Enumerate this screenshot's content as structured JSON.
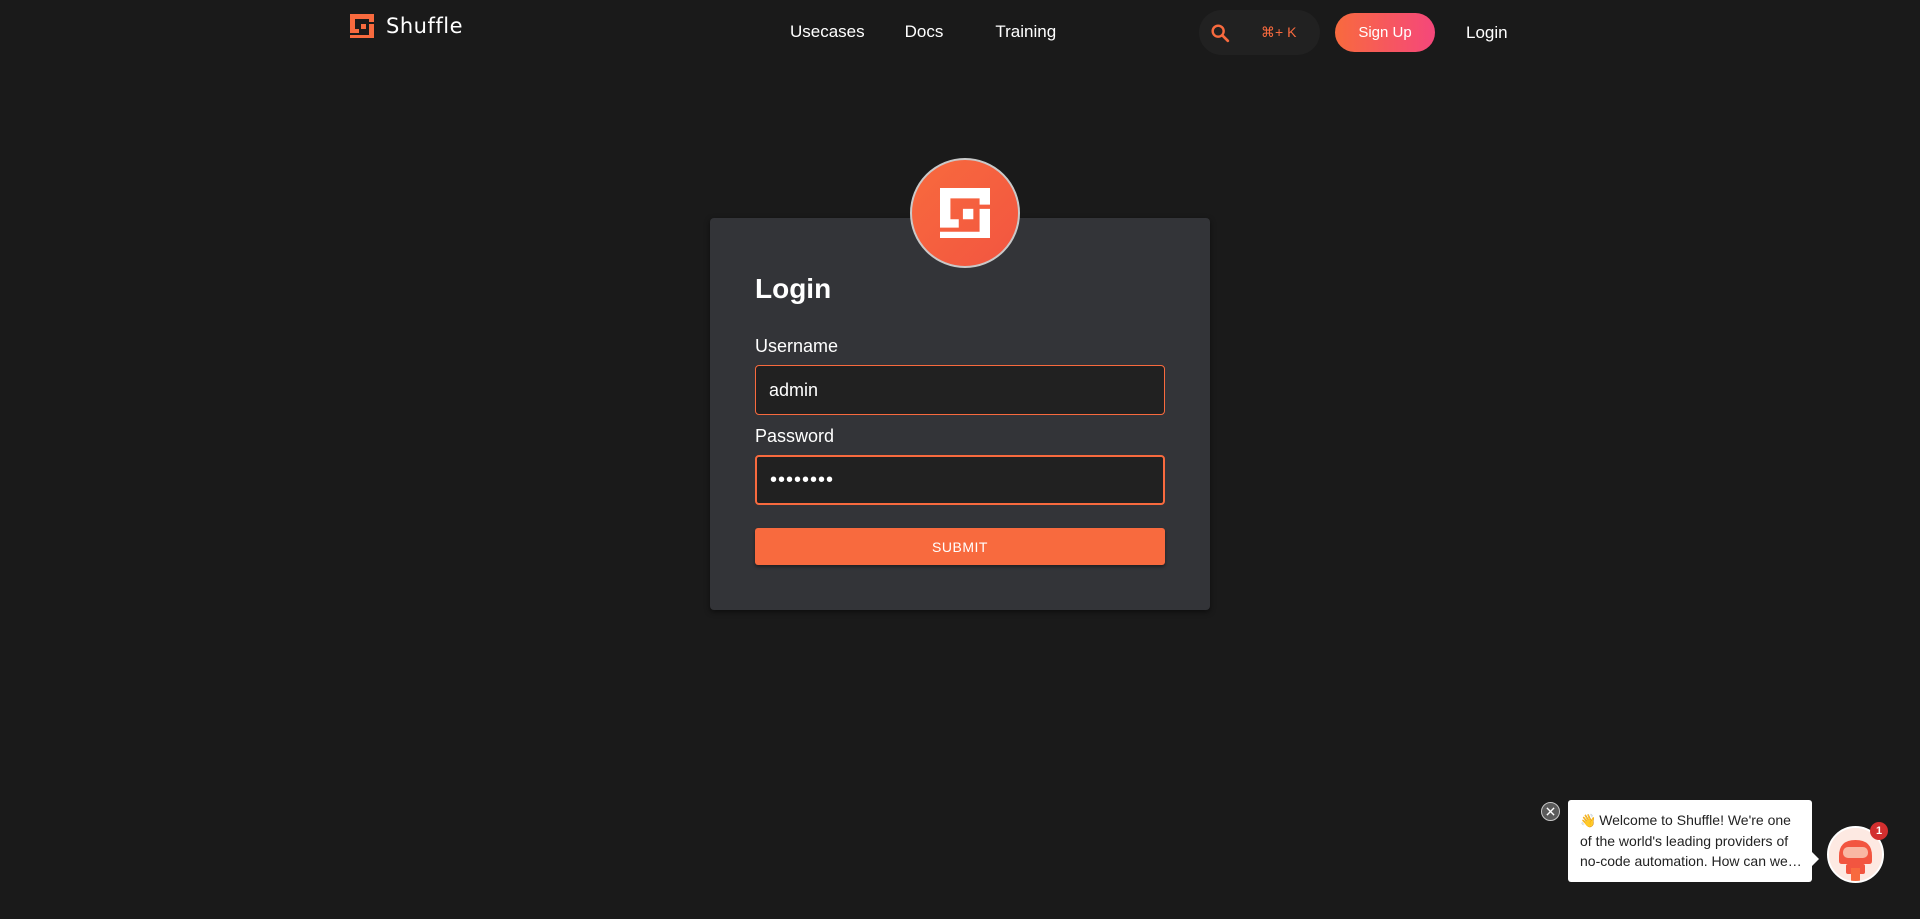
{
  "nav": {
    "brand_name": "Shuffle",
    "links": [
      "Usecases",
      "Docs",
      "Training"
    ],
    "search_shortcut": "⌘+ K",
    "signup_label": "Sign Up",
    "login_label": "Login"
  },
  "login": {
    "title": "Login",
    "username_label": "Username",
    "username_value": "admin",
    "password_label": "Password",
    "password_value": "password",
    "submit_label": "SUBMIT"
  },
  "chat": {
    "message": "Welcome to Shuffle! We're one of the world's leading providers of no-code automation. How can we help you today?",
    "unread_count": "1"
  },
  "colors": {
    "accent": "#f86a3e",
    "accent_pink": "#f5477b",
    "background": "#1a1a1a",
    "card": "#333438"
  },
  "icons": {
    "brand": "shuffle-logo-icon",
    "search": "search-icon",
    "close": "close-icon",
    "wave": "waving-hand-icon"
  }
}
